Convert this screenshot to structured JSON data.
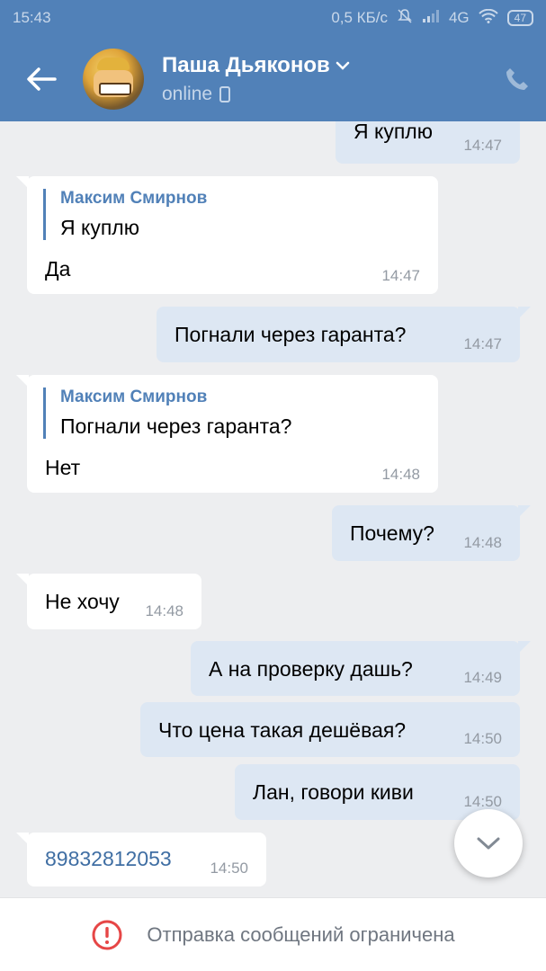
{
  "status_bar": {
    "time": "15:43",
    "net_speed": "0,5 КБ/с",
    "network": "4G",
    "battery": "47"
  },
  "header": {
    "contact_name": "Паша Дьяконов",
    "presence": "online"
  },
  "messages": [
    {
      "text": "Я куплю",
      "time": "14:47"
    },
    {
      "reply_name": "Максим Смирнов",
      "reply_text": "Я куплю",
      "text": "Да",
      "time": "14:47"
    },
    {
      "text": "Погнали через гаранта?",
      "time": "14:47"
    },
    {
      "reply_name": "Максим Смирнов",
      "reply_text": "Погнали через гаранта?",
      "text": "Нет",
      "time": "14:48"
    },
    {
      "text": "Почему?",
      "time": "14:48"
    },
    {
      "text": "Не хочу",
      "time": "14:48"
    },
    {
      "text": "А на проверку дашь?",
      "time": "14:49"
    },
    {
      "text": "Что цена такая дешёвая?",
      "time": "14:50"
    },
    {
      "text": "Лан, говори киви",
      "time": "14:50"
    },
    {
      "text": "89832812053",
      "time": "14:50"
    }
  ],
  "footer": {
    "restriction_text": "Отправка сообщений ограничена"
  },
  "colors": {
    "header_bg": "#5181b8",
    "outgoing_bubble": "#dde7f3",
    "incoming_bubble": "#ffffff",
    "chat_bg": "#edeef0",
    "warning": "#e64646",
    "link": "#3f6ea3"
  }
}
